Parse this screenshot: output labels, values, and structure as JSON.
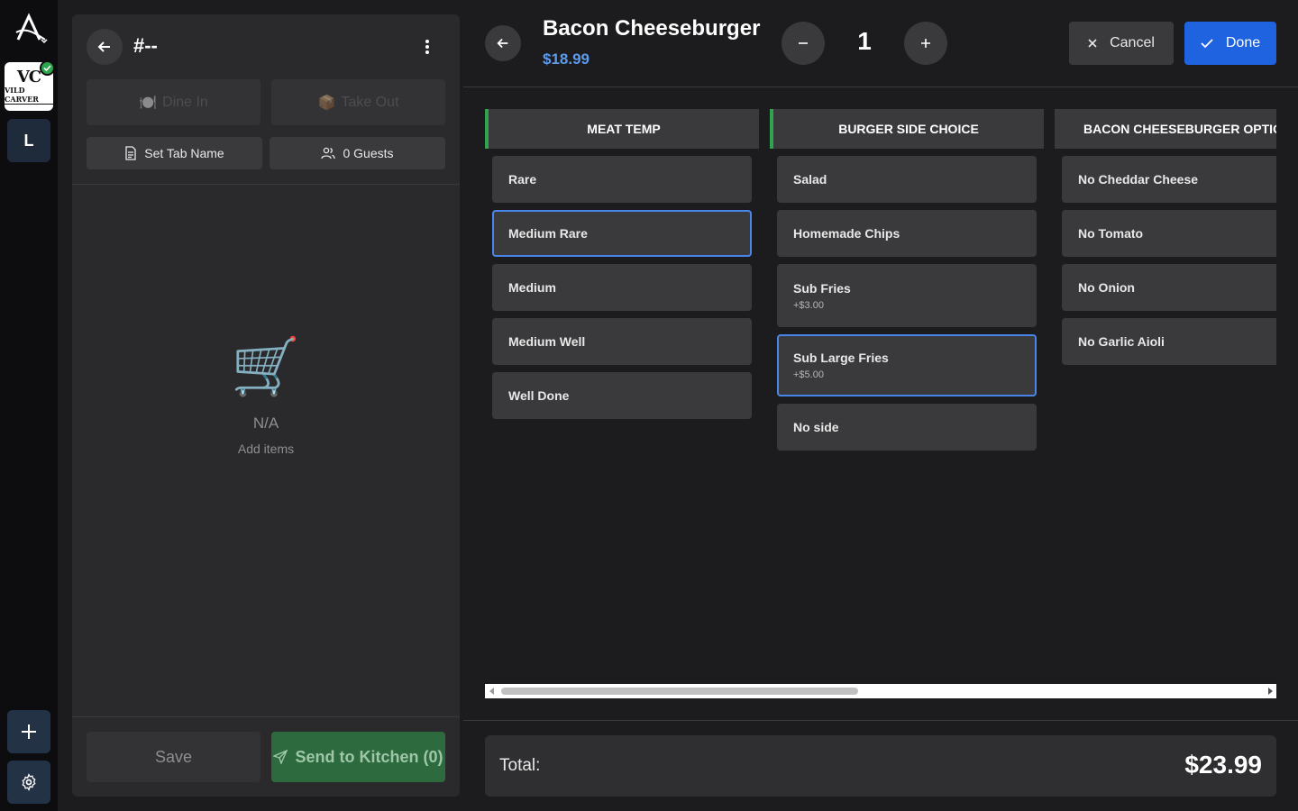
{
  "rail": {
    "logo_icon": "brand-logo-icon",
    "store": {
      "monogram": "VC",
      "name": "VILD CARVER"
    },
    "user_initial": "L",
    "add_icon": "plus-icon",
    "settings_icon": "gear-icon"
  },
  "order": {
    "title": "#--",
    "dine_in_label": "Dine In",
    "dine_in_emoji": "🍽️",
    "take_out_label": "Take Out",
    "take_out_emoji": "📦",
    "set_tab_label": "Set Tab Name",
    "guests_label": "0 Guests",
    "empty_icon": "🛒",
    "empty_title": "N/A",
    "empty_hint": "Add items",
    "save_label": "Save",
    "send_label": "Send to Kitchen (0)"
  },
  "item": {
    "name": "Bacon Cheeseburger",
    "price": "$18.99",
    "quantity": "1",
    "cancel_label": "Cancel",
    "done_label": "Done"
  },
  "modifier_groups": [
    {
      "title": "MEAT TEMP",
      "options": [
        {
          "label": "Rare",
          "price": "",
          "selected": false
        },
        {
          "label": "Medium Rare",
          "price": "",
          "selected": true
        },
        {
          "label": "Medium",
          "price": "",
          "selected": false
        },
        {
          "label": "Medium Well",
          "price": "",
          "selected": false
        },
        {
          "label": "Well Done",
          "price": "",
          "selected": false
        }
      ]
    },
    {
      "title": "BURGER SIDE CHOICE",
      "options": [
        {
          "label": "Salad",
          "price": "",
          "selected": false
        },
        {
          "label": "Homemade Chips",
          "price": "",
          "selected": false
        },
        {
          "label": "Sub Fries",
          "price": "+$3.00",
          "selected": false
        },
        {
          "label": "Sub Large Fries",
          "price": "+$5.00",
          "selected": true
        },
        {
          "label": "No side",
          "price": "",
          "selected": false
        }
      ]
    },
    {
      "title": "BACON CHEESEBURGER OPTIONS",
      "options": [
        {
          "label": "No Cheddar Cheese",
          "price": "",
          "selected": false
        },
        {
          "label": "No Tomato",
          "price": "",
          "selected": false
        },
        {
          "label": "No Onion",
          "price": "",
          "selected": false
        },
        {
          "label": "No Garlic Aioli",
          "price": "",
          "selected": false
        }
      ]
    }
  ],
  "total": {
    "label": "Total:",
    "value": "$23.99"
  },
  "colors": {
    "accent_blue": "#1f63e0",
    "price_blue": "#5b9bf0",
    "group_accent": "#2ea44f",
    "send_green": "#2d6a3e"
  }
}
